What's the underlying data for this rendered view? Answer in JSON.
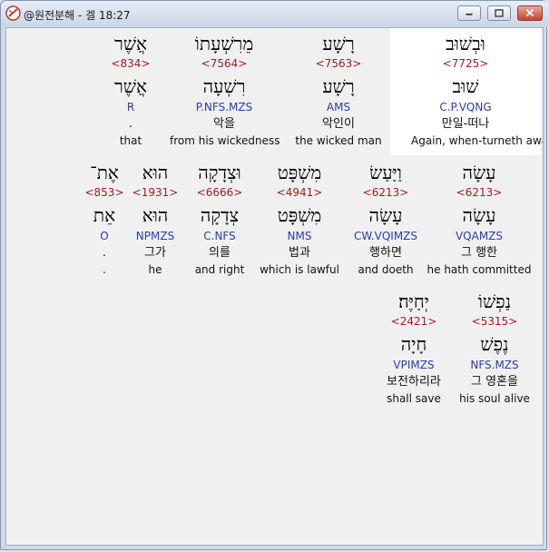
{
  "window": {
    "title": "@원전분해 - 겔 18:27",
    "colors": {
      "number": "#9b1c1c",
      "parse": "#2a3bb0",
      "highlight": "#ffffff"
    }
  },
  "rows": [
    [
      {
        "heb": "וּבְשׁוּב",
        "num": "<7725>",
        "root": "שׁוּב",
        "parse": "C.P.VQNG",
        "kor": "만일-떠나",
        "eng": "Again, when-turneth away"
      },
      {
        "heb": "רָשָׁע",
        "num": "<7563>",
        "root": "רָשָׁע",
        "parse": "AMS",
        "kor": "악인이",
        "eng": "the wicked man"
      },
      {
        "heb": "מֵרִשְׁעָתוֹ",
        "num": "<7564>",
        "root": "רִשְׁעָה",
        "parse": "P.NFS.MZS",
        "kor": "악을",
        "eng": "from his wickedness"
      },
      {
        "heb": "אֲשֶׁר",
        "num": "<834>",
        "root": "אֲשֶׁר",
        "parse": "R",
        "kor": ".",
        "eng": "that"
      }
    ],
    [
      {
        "heb": "עָשָׂה",
        "num": "<6213>",
        "root": "עָשָׂה",
        "parse": "VQAMZS",
        "kor": "그 행한",
        "eng": "he hath committed"
      },
      {
        "heb": "וַיַּעַשׂ",
        "num": "<6213>",
        "root": "עָשָׂה",
        "parse": "CW.VQIMZS",
        "kor": "행하면",
        "eng": "and doeth"
      },
      {
        "heb": "מִשְׁפָּט",
        "num": "<4941>",
        "root": "מִשְׁפָּט",
        "parse": "NMS",
        "kor": "법과",
        "eng": "which is lawful"
      },
      {
        "heb": "וּצְדָקָה",
        "num": "<6666>",
        "root": "צְדָקָה",
        "parse": "C.NFS",
        "kor": "의를",
        "eng": "and right"
      },
      {
        "heb": "הוּא",
        "num": "<1931>",
        "root": "הוּא",
        "parse": "NPMZS",
        "kor": "그가",
        "eng": "he"
      },
      {
        "heb": "אֶת־",
        "num": "<853>",
        "root": "אֵת",
        "parse": "O",
        "kor": ".",
        "eng": "."
      }
    ],
    [
      {
        "heb": "נַפְשׁוֹ",
        "num": "<5315>",
        "root": "נֶפֶשׁ",
        "parse": "NFS.MZS",
        "kor": "그 영혼을",
        "eng": "his soul alive"
      },
      {
        "heb": "יְחַיֶּה׃",
        "num": "<2421>",
        "root": "חָיָה",
        "parse": "VPIMZS",
        "kor": "보전하리라",
        "eng": "shall save"
      }
    ]
  ]
}
